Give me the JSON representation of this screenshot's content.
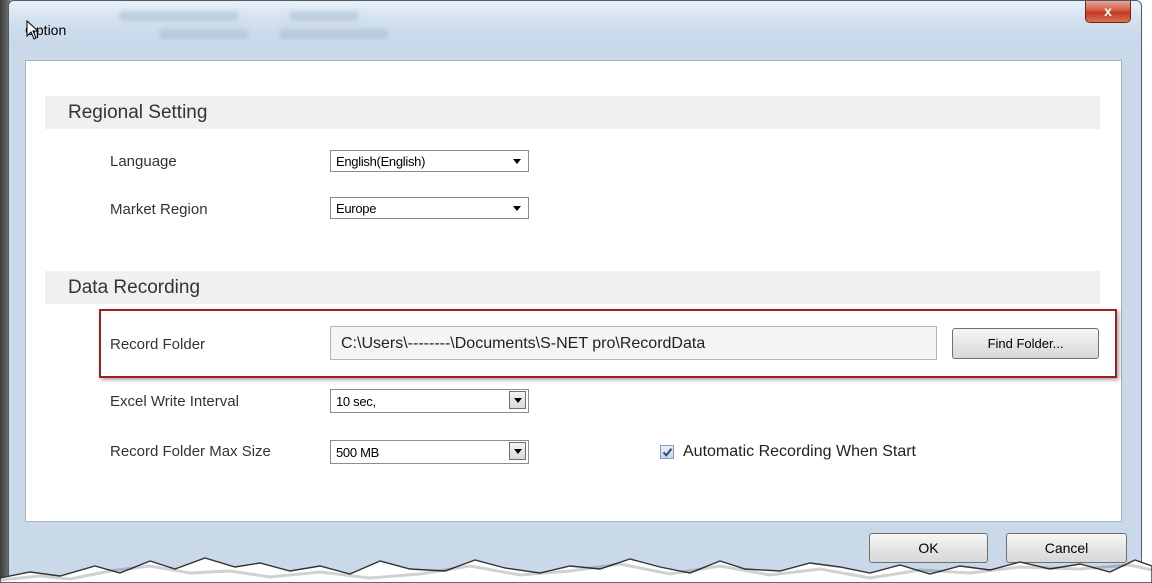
{
  "window": {
    "title": "Option",
    "close_label": "x"
  },
  "regional": {
    "header": "Regional Setting",
    "language_label": "Language",
    "language_value": "English(English)",
    "region_label": "Market Region",
    "region_value": "Europe"
  },
  "recording": {
    "header": "Data Recording",
    "folder_label": "Record Folder",
    "folder_path": "C:\\Users\\--------\\Documents\\S-NET  pro\\RecordData",
    "find_folder_label": "Find Folder...",
    "interval_label": "Excel Write Interval",
    "interval_value": "10 sec,",
    "maxsize_label": "Record Folder Max Size",
    "maxsize_value": "500 MB",
    "auto_record_label": "Automatic Recording When Start",
    "auto_record_checked": true
  },
  "footer": {
    "ok_label": "OK",
    "cancel_label": "Cancel"
  }
}
